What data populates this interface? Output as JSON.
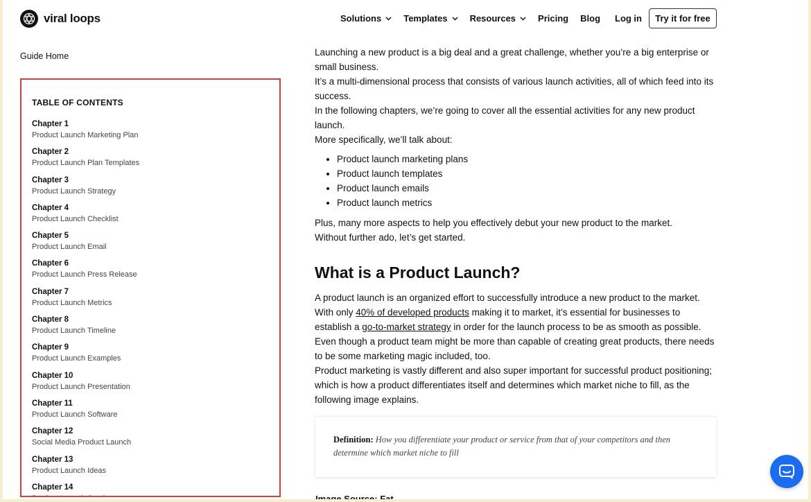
{
  "header": {
    "brand": "viral loops",
    "nav": [
      "Solutions",
      "Templates",
      "Resources",
      "Pricing",
      "Blog"
    ],
    "nav_dropdowns": [
      true,
      true,
      true,
      false,
      false
    ],
    "login": "Log in",
    "cta": "Try it for free"
  },
  "sidebar": {
    "guide_home": "Guide Home",
    "toc_title": "TABLE OF CONTENTS",
    "chapters": [
      {
        "chapter": "Chapter 1",
        "title": "Product Launch Marketing Plan"
      },
      {
        "chapter": "Chapter 2",
        "title": "Product Launch Plan Templates"
      },
      {
        "chapter": "Chapter 3",
        "title": "Product Launch Strategy"
      },
      {
        "chapter": "Chapter 4",
        "title": "Product Launch Checklist"
      },
      {
        "chapter": "Chapter 5",
        "title": "Product Launch Email"
      },
      {
        "chapter": "Chapter 6",
        "title": "Product Launch Press Release"
      },
      {
        "chapter": "Chapter 7",
        "title": "Product Launch Metrics"
      },
      {
        "chapter": "Chapter 8",
        "title": "Product Launch Timeline"
      },
      {
        "chapter": "Chapter 9",
        "title": "Product Launch Examples"
      },
      {
        "chapter": "Chapter 10",
        "title": "Product Launch Presentation"
      },
      {
        "chapter": "Chapter 11",
        "title": "Product Launch Software"
      },
      {
        "chapter": "Chapter 12",
        "title": "Social Media Product Launch"
      },
      {
        "chapter": "Chapter 13",
        "title": "Product Launch Ideas"
      },
      {
        "chapter": "Chapter 14",
        "title": "Product Launch Services"
      }
    ],
    "highlight_color": "#e03a3a"
  },
  "article": {
    "intro": [
      "Launching a new product is a big deal and a great challenge, whether you’re a big enterprise or small business.",
      "It’s a multi-dimensional process that consists of various launch activities, all of which feed into its success.",
      "In the following chapters, we’re going to cover all the essential activities for any new product launch.",
      "More specifically, we’ll talk about:"
    ],
    "bullets": [
      "Product launch marketing plans",
      "Product launch templates",
      "Product launch emails",
      "Product launch metrics"
    ],
    "outro": [
      "Plus, many more aspects to help you effectively debut your new product to the market.",
      "Without further ado, let’s get started."
    ],
    "heading": "What is a Product Launch?",
    "p1": "A product launch is an organized effort to successfully introduce a new product to the market.",
    "p2_a": "With only ",
    "p2_link": "40% of developed products",
    "p2_b": " making it to market, it’s essential for businesses to establish a ",
    "p2_link2": "go-to-market strategy",
    "p2_c": " in order for the launch process to be as smooth as possible.",
    "p3": "Even though a product team might be more than capable of creating great products, there needs to be some marketing magic included, too.",
    "p4": "Product marketing is vastly different and also super important for successful product positioning; which is how a product differentiates itself and determines which market niche to fill, as the following image explains.",
    "definition_label": "Definition:",
    "definition_text": "How you differentiate your product or service from that of your competitors and then determine which market niche to fill",
    "truncated_text": "Image Source: Fat..."
  },
  "chat": {
    "icon": "chat-icon",
    "color": "#1c6cf0"
  }
}
